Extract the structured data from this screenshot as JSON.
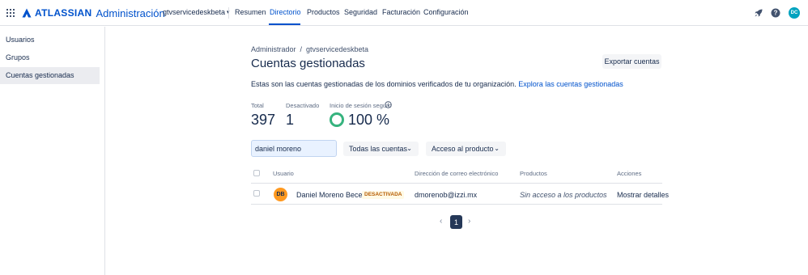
{
  "header": {
    "brand": "ATLASSIAN",
    "app_title": "Administración",
    "org_name": "gtvservicedeskbeta",
    "nav": [
      "Resumen",
      "Directorio",
      "Productos",
      "Seguridad",
      "Facturación",
      "Configuración"
    ],
    "active_nav": "Directorio",
    "avatar_initials": "DC",
    "icons": [
      "rocket-icon",
      "help-icon"
    ]
  },
  "sidebar": {
    "items": [
      "Usuarios",
      "Grupos",
      "Cuentas gestionadas"
    ],
    "active": "Cuentas gestionadas"
  },
  "main": {
    "breadcrumb": "Administrador  /  gtvservicedeskbeta",
    "title": "Cuentas gestionadas",
    "export_button": "Exportar cuentas",
    "description": "Estas son las cuentas gestionadas de los dominios verificados de tu organización.",
    "description_link": "Explora las cuentas gestionadas",
    "stats": {
      "total_label": "Total",
      "total_value": "397",
      "deactivated_label": "Desactivado",
      "deactivated_value": "1",
      "secure_login_label": "Inicio de sesión seguro",
      "secure_login_value": "100 %"
    },
    "filters": {
      "search_value": "daniel moreno",
      "accounts_dropdown": "Todas las cuentas",
      "product_dropdown": "Acceso al producto"
    },
    "table": {
      "columns": [
        "Usuario",
        "Dirección de correo electrónico",
        "Productos",
        "Acciones"
      ],
      "rows": [
        {
          "initials": "DB",
          "name": "Daniel Moreno Becerra",
          "status": "DESACTIVADA",
          "email": "dmorenob@izzi.mx",
          "products": "Sin acceso a los productos",
          "action": "Mostrar detalles"
        }
      ]
    },
    "pagination": {
      "current_page": "1",
      "prev": "‹",
      "next": "›"
    }
  },
  "colors": {
    "brand_blue": "#0052cc",
    "success_green": "#36b37e",
    "avatar_orange": "#ff991f",
    "deactivated_text": "#b65c02"
  }
}
